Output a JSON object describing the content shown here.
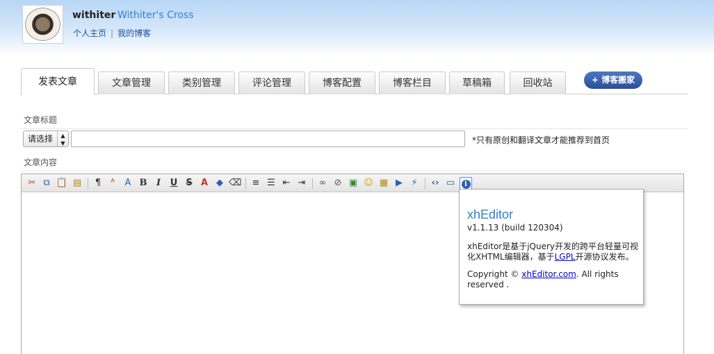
{
  "header": {
    "username": "withiter",
    "blog_title": "Withiter's Cross",
    "links": [
      "个人主页",
      "我的博客"
    ],
    "separator": "|"
  },
  "tabs": [
    {
      "label": "发表文章",
      "active": true
    },
    {
      "label": "文章管理",
      "active": false
    },
    {
      "label": "类别管理",
      "active": false
    },
    {
      "label": "评论管理",
      "active": false
    },
    {
      "label": "博客配置",
      "active": false
    },
    {
      "label": "博客栏目",
      "active": false
    },
    {
      "label": "草稿箱",
      "active": false
    },
    {
      "label": "回收站",
      "active": false
    }
  ],
  "move_button": {
    "label": "+ 博客搬家"
  },
  "form": {
    "title_label": "文章标题",
    "type_select": {
      "selected": "请选择"
    },
    "title_value": "",
    "note": "*只有原创和翻译文章才能推荐到首页",
    "content_label": "文章内容"
  },
  "toolbar": {
    "icons": [
      "cut-icon",
      "copy-icon",
      "paste-icon",
      "paste-text-icon",
      "sep",
      "block-format-icon",
      "font-family-icon",
      "font-size-icon",
      "bold-icon",
      "italic-icon",
      "underline-icon",
      "strikethrough-icon",
      "font-color-icon",
      "background-color-icon",
      "remove-format-icon",
      "sep",
      "align-icon",
      "list-icon",
      "outdent-icon",
      "indent-icon",
      "sep",
      "link-icon",
      "unlink-icon",
      "image-icon",
      "emoticon-icon",
      "table-icon",
      "media-icon",
      "flash-icon",
      "sep",
      "source-icon",
      "preview-icon",
      "about-icon"
    ]
  },
  "about_popup": {
    "title": "xhEditor",
    "version": "v1.1.13 (build 120304)",
    "desc_before": "xhEditor是基于jQuery开发的跨平台轻量可视化XHTML编辑器，基于",
    "desc_link": "LGPL",
    "desc_after": "开源协议发布。",
    "copy_before": "Copyright © ",
    "copy_link": "xhEditor.com",
    "copy_after": ". All rights reserved ."
  }
}
